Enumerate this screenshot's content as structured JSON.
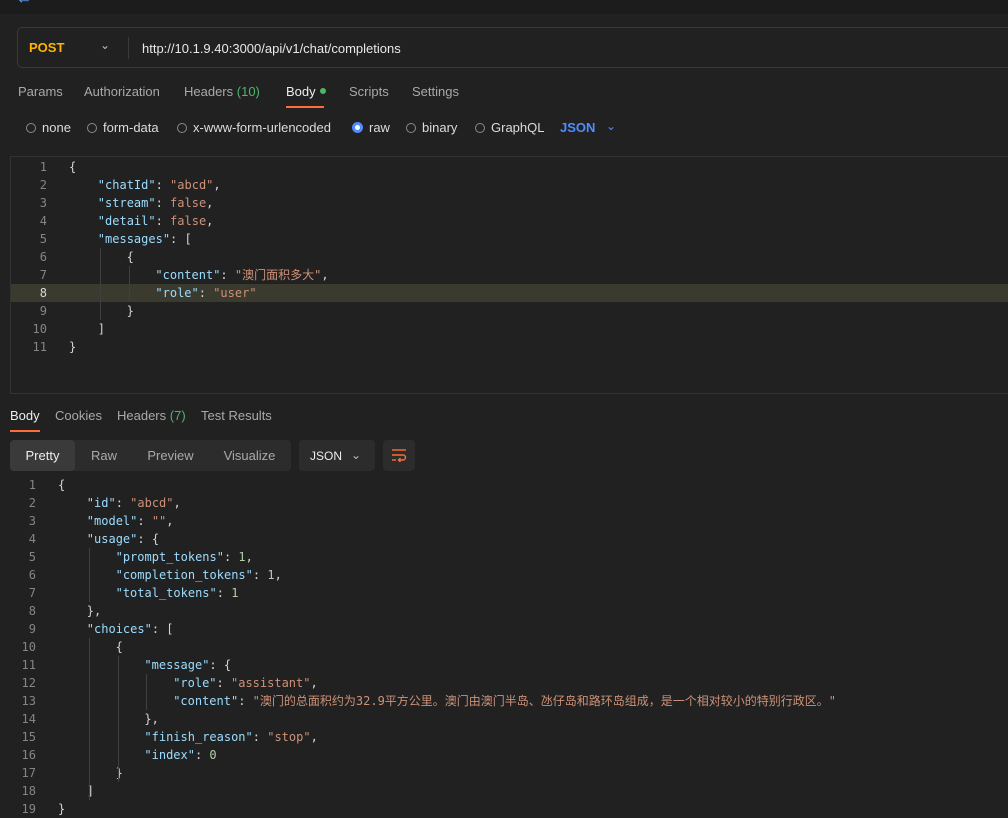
{
  "request": {
    "method": "POST",
    "url": "http://10.1.9.40:3000/api/v1/chat/completions"
  },
  "request_tabs": [
    {
      "label": "Params"
    },
    {
      "label": "Authorization"
    },
    {
      "label": "Headers",
      "count": "(10)"
    },
    {
      "label": "Body"
    },
    {
      "label": "Scripts"
    },
    {
      "label": "Settings"
    }
  ],
  "body_types": [
    "none",
    "form-data",
    "x-www-form-urlencoded",
    "raw",
    "binary",
    "GraphQL"
  ],
  "body_type_selected": "raw",
  "body_language": "JSON",
  "request_body_lines": [
    {
      "num": "1",
      "indent": 0,
      "parts": [
        [
          "p",
          "{"
        ]
      ]
    },
    {
      "num": "2",
      "indent": 1,
      "parts": [
        [
          "k",
          "\"chatId\""
        ],
        [
          "p",
          ": "
        ],
        [
          "s",
          "\"abcd\""
        ],
        [
          "p",
          ","
        ]
      ]
    },
    {
      "num": "3",
      "indent": 1,
      "parts": [
        [
          "k",
          "\"stream\""
        ],
        [
          "p",
          ": "
        ],
        [
          "s",
          "false"
        ],
        [
          "p",
          ","
        ]
      ]
    },
    {
      "num": "4",
      "indent": 1,
      "parts": [
        [
          "k",
          "\"detail\""
        ],
        [
          "p",
          ": "
        ],
        [
          "s",
          "false"
        ],
        [
          "p",
          ","
        ]
      ]
    },
    {
      "num": "5",
      "indent": 1,
      "parts": [
        [
          "k",
          "\"messages\""
        ],
        [
          "p",
          ": ["
        ]
      ]
    },
    {
      "num": "6",
      "indent": 2,
      "parts": [
        [
          "p",
          "{"
        ]
      ]
    },
    {
      "num": "7",
      "indent": 3,
      "parts": [
        [
          "k",
          "\"content\""
        ],
        [
          "p",
          ": "
        ],
        [
          "s",
          "\"澳门面积多大\""
        ],
        [
          "p",
          ","
        ]
      ]
    },
    {
      "num": "8",
      "indent": 3,
      "parts": [
        [
          "k",
          "\"role\""
        ],
        [
          "p",
          ": "
        ],
        [
          "s",
          "\"user\""
        ]
      ]
    },
    {
      "num": "9",
      "indent": 2,
      "parts": [
        [
          "p",
          "}"
        ]
      ]
    },
    {
      "num": "10",
      "indent": 1,
      "parts": [
        [
          "p",
          "]"
        ]
      ]
    },
    {
      "num": "11",
      "indent": 0,
      "parts": [
        [
          "p",
          "}"
        ]
      ]
    }
  ],
  "response_tabs": [
    {
      "label": "Body"
    },
    {
      "label": "Cookies"
    },
    {
      "label": "Headers",
      "count": "(7)"
    },
    {
      "label": "Test Results"
    }
  ],
  "view_modes": [
    "Pretty",
    "Raw",
    "Preview",
    "Visualize"
  ],
  "view_mode_selected": "Pretty",
  "response_format": "JSON",
  "response_body_lines": [
    {
      "num": "1",
      "indent": 0,
      "parts": [
        [
          "p",
          "{"
        ]
      ]
    },
    {
      "num": "2",
      "indent": 1,
      "parts": [
        [
          "k",
          "\"id\""
        ],
        [
          "p",
          ": "
        ],
        [
          "s",
          "\"abcd\""
        ],
        [
          "p",
          ","
        ]
      ]
    },
    {
      "num": "3",
      "indent": 1,
      "parts": [
        [
          "k",
          "\"model\""
        ],
        [
          "p",
          ": "
        ],
        [
          "s",
          "\"\""
        ],
        [
          "p",
          ","
        ]
      ]
    },
    {
      "num": "4",
      "indent": 1,
      "parts": [
        [
          "k",
          "\"usage\""
        ],
        [
          "p",
          ": {"
        ]
      ]
    },
    {
      "num": "5",
      "indent": 2,
      "parts": [
        [
          "k",
          "\"prompt_tokens\""
        ],
        [
          "p",
          ": "
        ],
        [
          "n",
          "1"
        ],
        [
          "p",
          ","
        ]
      ]
    },
    {
      "num": "6",
      "indent": 2,
      "parts": [
        [
          "k",
          "\"completion_tokens\""
        ],
        [
          "p",
          ": "
        ],
        [
          "n",
          "1"
        ],
        [
          "p",
          ","
        ]
      ]
    },
    {
      "num": "7",
      "indent": 2,
      "parts": [
        [
          "k",
          "\"total_tokens\""
        ],
        [
          "p",
          ": "
        ],
        [
          "n",
          "1"
        ]
      ]
    },
    {
      "num": "8",
      "indent": 1,
      "parts": [
        [
          "p",
          "},"
        ]
      ]
    },
    {
      "num": "9",
      "indent": 1,
      "parts": [
        [
          "k",
          "\"choices\""
        ],
        [
          "p",
          ": ["
        ]
      ]
    },
    {
      "num": "10",
      "indent": 2,
      "parts": [
        [
          "p",
          "{"
        ]
      ]
    },
    {
      "num": "11",
      "indent": 3,
      "parts": [
        [
          "k",
          "\"message\""
        ],
        [
          "p",
          ": {"
        ]
      ]
    },
    {
      "num": "12",
      "indent": 4,
      "parts": [
        [
          "k",
          "\"role\""
        ],
        [
          "p",
          ": "
        ],
        [
          "s",
          "\"assistant\""
        ],
        [
          "p",
          ","
        ]
      ]
    },
    {
      "num": "13",
      "indent": 4,
      "parts": [
        [
          "k",
          "\"content\""
        ],
        [
          "p",
          ": "
        ],
        [
          "s",
          "\"澳门的总面积约为32.9平方公里。澳门由澳门半岛、氹仔岛和路环岛组成，是一个相对较小的特别行政区。\""
        ]
      ]
    },
    {
      "num": "14",
      "indent": 3,
      "parts": [
        [
          "p",
          "},"
        ]
      ]
    },
    {
      "num": "15",
      "indent": 3,
      "parts": [
        [
          "k",
          "\"finish_reason\""
        ],
        [
          "p",
          ": "
        ],
        [
          "s",
          "\"stop\""
        ],
        [
          "p",
          ","
        ]
      ]
    },
    {
      "num": "16",
      "indent": 3,
      "parts": [
        [
          "k",
          "\"index\""
        ],
        [
          "p",
          ": "
        ],
        [
          "n",
          "0"
        ]
      ]
    },
    {
      "num": "17",
      "indent": 2,
      "parts": [
        [
          "p",
          "}"
        ]
      ]
    },
    {
      "num": "18",
      "indent": 1,
      "parts": [
        [
          "p",
          "]"
        ]
      ]
    },
    {
      "num": "19",
      "indent": 0,
      "parts": [
        [
          "p",
          "}"
        ]
      ]
    }
  ],
  "colors": {
    "method": "#ffb400",
    "accent": "#ff6c37",
    "count": "#4fb66a",
    "json_key": "#9cdcfe",
    "json_string": "#ce9178",
    "json_number": "#b5cea8"
  }
}
